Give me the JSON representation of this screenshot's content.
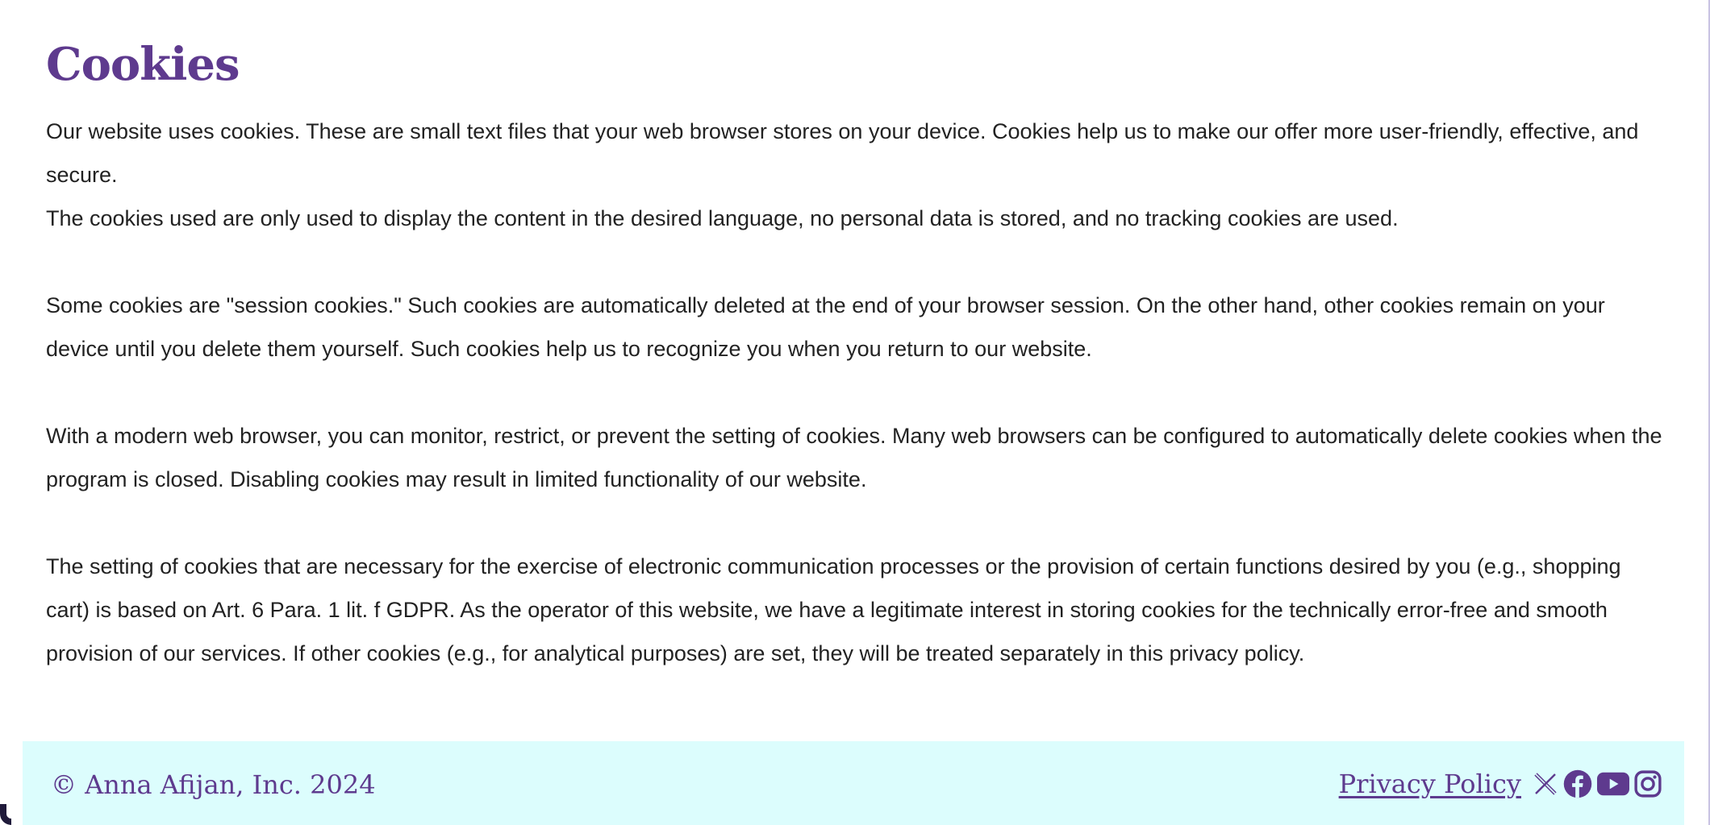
{
  "page": {
    "title": "Cookies",
    "paragraphs": [
      "Our website uses cookies. These are small text files that your web browser stores on your device. Cookies help us to make our offer more user-friendly, effective, and secure.",
      "The cookies used are only used to display the content in the desired language, no personal data is stored, and no tracking cookies are used.",
      "Some cookies are \"session cookies.\" Such cookies are automatically deleted at the end of your browser session. On the other hand, other cookies remain on your device until you delete them yourself. Such cookies help us to recognize you when you return to our website.",
      "With a modern web browser, you can monitor, restrict, or prevent the setting of cookies. Many web browsers can be configured to automatically delete cookies when the program is closed. Disabling cookies may result in limited functionality of our website.",
      "The setting of cookies that are necessary for the exercise of electronic communication processes or the provision of certain functions desired by you (e.g., shopping cart) is based on Art. 6 Para. 1 lit. f GDPR. As the operator of this website, we have a legitimate interest in storing cookies for the technically error-free and smooth provision of our services. If other cookies (e.g., for analytical purposes) are set, they will be treated separately in this privacy policy."
    ]
  },
  "footer": {
    "copyright": "© Anna Afijan, Inc. 2024",
    "privacy_link": "Privacy Policy",
    "social_icons": [
      "x-icon",
      "facebook-icon",
      "youtube-icon",
      "instagram-icon"
    ]
  },
  "colors": {
    "accent": "#5e3a8e",
    "footer_bg": "#dcfdfd",
    "text": "#222222"
  }
}
